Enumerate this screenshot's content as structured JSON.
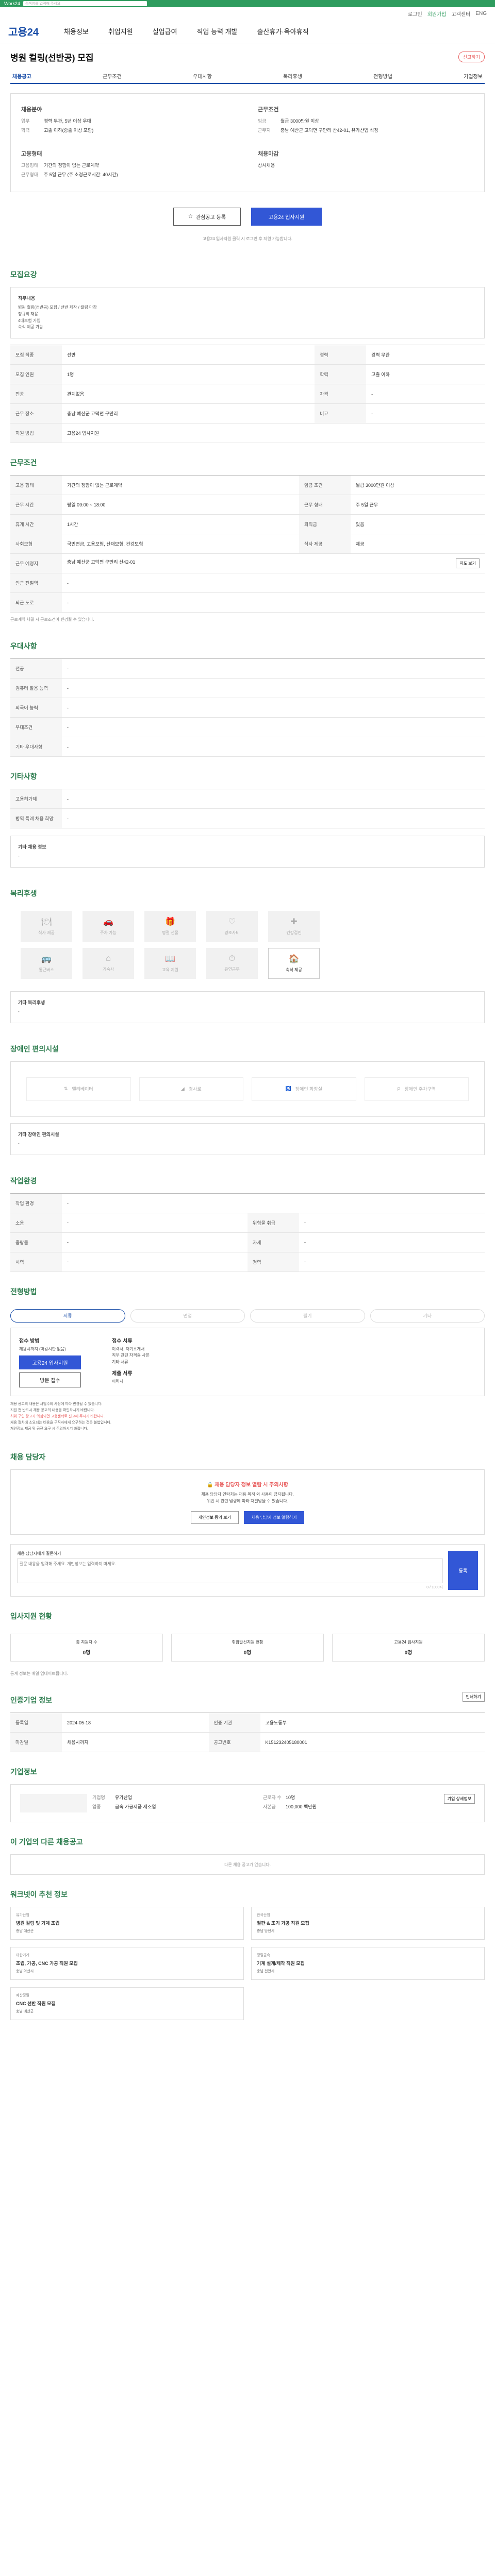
{
  "topbar": {
    "brand": "Work24",
    "search_placeholder": "검색어를 입력해 주세요"
  },
  "util": {
    "items": [
      "로그인",
      "회원가입",
      "고객센터",
      "ENG"
    ]
  },
  "gnb": {
    "logo": "고용24",
    "menu": [
      "채용정보",
      "취업지원",
      "실업급여",
      "직업 능력 개발",
      "출산휴가·육아휴직"
    ]
  },
  "job": {
    "title": "병원 컬링(선반공) 모집",
    "report": "신고하기"
  },
  "tabs": [
    "채용공고",
    "근무조건",
    "우대사항",
    "복리후생",
    "전형방법",
    "기업정보"
  ],
  "summary": {
    "recruit": {
      "heading": "채용분야",
      "rows": [
        {
          "k": "업무",
          "v": "경력 무관, 5년 이상 우대"
        },
        {
          "k": "학력",
          "v": "고졸 이하(중졸 이상 포함)"
        }
      ]
    },
    "condition": {
      "heading": "근무조건",
      "rows": [
        {
          "k": "임금",
          "v": "월급 3000만원 이상"
        },
        {
          "k": "근무지",
          "v": "충남 예산군 고덕면 구만리 산42-01, 유가산업 석정"
        }
      ]
    },
    "type": {
      "heading": "고용형태",
      "rows": [
        {
          "k": "고용형태",
          "v": "기간의 정함이 없는 근로계약"
        },
        {
          "k": "근무형태",
          "v": "주 5일 근무 (주 소정근로시간: 40시간)"
        }
      ]
    },
    "deadline": {
      "heading": "채용마감",
      "rows": [
        {
          "k": "",
          "v": "상시채용"
        }
      ]
    }
  },
  "actions": {
    "save": "관심공고 등록",
    "apply": "고용24 입사지원"
  },
  "notice": "고용24 입사지원 클릭 시 로그인 후 지원 가능합니다.",
  "recruit": {
    "heading": "모집요강",
    "desc_title": "직무내용",
    "desc": [
      "병원 컬링(선반공) 모집 / 선반 제작 / 컬링 마감",
      "정규직 채용",
      "4대보험 가입",
      "숙식 제공 가능"
    ],
    "rows": [
      {
        "k": "모집 직종",
        "v": "선반",
        "k2": "경력",
        "v2": "경력 무관"
      },
      {
        "k": "모집 인원",
        "v": "1명",
        "k2": "학력",
        "v2": "고졸 이하"
      },
      {
        "k": "전공",
        "v": "관계없음",
        "k2": "자격",
        "v2": "-"
      },
      {
        "k": "근무 장소",
        "v": "충남 예산군 고덕면 구만리",
        "k2": "비고",
        "v2": "-"
      },
      {
        "k": "지원 방법",
        "v": "고용24 입사지원",
        "k2": "",
        "v2": ""
      }
    ]
  },
  "conditions": {
    "heading": "근무조건",
    "rows": [
      {
        "k": "고용 형태",
        "v": "기간의 정함이 없는 근로계약",
        "k2": "임금 조건",
        "v2": "월급 3000만원 이상"
      },
      {
        "k": "근무 시간",
        "v": "평일 09:00 ~ 18:00",
        "k2": "근무 형태",
        "v2": "주 5일 근무"
      },
      {
        "k": "휴게 시간",
        "v": "1시간",
        "k2": "퇴직금",
        "v2": "있음"
      },
      {
        "k": "사회보험",
        "v": "국민연금, 고용보험, 산재보험, 건강보험",
        "k2": "식사 제공",
        "v2": "제공"
      },
      {
        "k": "근무 예정지",
        "v": "충남 예산군 고덕면 구만리 산42-01",
        "k2": "",
        "v2": ""
      },
      {
        "k": "인근 전철역",
        "v": "-",
        "k2": "",
        "v2": ""
      },
      {
        "k": "퇴근 도로",
        "v": "-",
        "k2": "",
        "v2": ""
      }
    ],
    "map_btn": "지도 보기",
    "note": "근로계약 체결 시 근로조건이 변경될 수 있습니다."
  },
  "prefer": {
    "heading": "우대사항",
    "rows": [
      {
        "k": "전공",
        "v": "-"
      },
      {
        "k": "컴퓨터 활용 능력",
        "v": "-"
      },
      {
        "k": "외국어 능력",
        "v": "-"
      },
      {
        "k": "우대조건",
        "v": "-"
      },
      {
        "k": "기타 우대사항",
        "v": "-"
      }
    ]
  },
  "other": {
    "heading": "기타사항",
    "rows": [
      {
        "k": "고용허가제",
        "v": "-"
      },
      {
        "k": "병역 특례 채용 희망",
        "v": "-"
      }
    ],
    "extra_title": "기타 채용 정보",
    "extra": "-"
  },
  "welfare": {
    "heading": "복리후생",
    "items": [
      {
        "icon": "food-icon",
        "label": "식사 제공",
        "on": false
      },
      {
        "icon": "car-icon",
        "label": "주차 가능",
        "on": false
      },
      {
        "icon": "gift-icon",
        "label": "명절 선물",
        "on": false
      },
      {
        "icon": "heart-icon",
        "label": "경조사비",
        "on": false
      },
      {
        "icon": "health-icon",
        "label": "건강검진",
        "on": false
      },
      {
        "icon": "bus-icon",
        "label": "통근버스",
        "on": false
      },
      {
        "icon": "house-icon",
        "label": "기숙사",
        "on": false
      },
      {
        "icon": "book-icon",
        "label": "교육 지원",
        "on": false
      },
      {
        "icon": "clock-icon",
        "label": "유연근무",
        "on": false
      },
      {
        "icon": "dorm-icon",
        "label": "숙식 제공",
        "on": true
      }
    ],
    "extra_title": "기타 복리후생",
    "extra": "-"
  },
  "facility": {
    "heading": "장애인 편의시설",
    "items": [
      "엘리베이터",
      "경사로",
      "장애인 화장실",
      "장애인 주차구역"
    ],
    "extra_title": "기타 장애인 편의시설",
    "extra": "-"
  },
  "workenv": {
    "heading": "작업환경",
    "rows": [
      {
        "k": "작업 환경",
        "v": "-",
        "k2": "",
        "v2": ""
      },
      {
        "k": "소음",
        "v": "-",
        "k2": "위험물 취급",
        "v2": "-"
      },
      {
        "k": "중량물",
        "v": "-",
        "k2": "자세",
        "v2": "-"
      },
      {
        "k": "시력",
        "v": "-",
        "k2": "청력",
        "v2": "-"
      }
    ]
  },
  "selection": {
    "heading": "전형방법",
    "steps": [
      {
        "label": "서류",
        "on": true
      },
      {
        "label": "면접",
        "on": false
      },
      {
        "label": "필기",
        "on": false
      },
      {
        "label": "기타",
        "on": false
      }
    ],
    "apply_title": "접수 방법",
    "apply_line": "채용시까지 (마감시한 없음)",
    "apply_btn": "고용24 입사지원",
    "apply_btn2": "방문 접수",
    "doc_title": "접수 서류",
    "doc_lines": [
      "이력서, 자기소개서",
      "직무 관련 자격증 사본",
      "기타 서류"
    ],
    "doc_extra_title": "제출 서류",
    "doc_extra": "이력서"
  },
  "warnings": [
    "채용 공고의 내용은 사업주의 사정에 따라 변경될 수 있습니다.",
    "지원 전 반드시 채용 공고의 내용을 확인하시기 바랍니다.",
    "허위 구인 광고가 의심되면 고용센터로 신고해 주시기 바랍니다.",
    "채용 절차에 소요되는 비용을 구직자에게 요구하는 것은 불법입니다.",
    "개인정보 제공 및 금전 요구 시 주의하시기 바랍니다."
  ],
  "manager": {
    "heading": "채용 담당자",
    "lock": "채용 담당자 정보 열람 시 주의사항",
    "desc": [
      "채용 담당자 연락처는 채용 목적 외 사용이 금지됩니다.",
      "위반 시 관련 법령에 따라 처벌받을 수 있습니다."
    ],
    "btn1": "개인정보 동의 보기",
    "btn2": "채용 담당자 정보 열람하기"
  },
  "qna": {
    "label": "채용 담당자에게 질문하기",
    "placeholder": "질문 내용을 입력해 주세요. 개인정보는 입력하지 마세요.",
    "count": "0 / 1000자",
    "submit": "등록"
  },
  "stats": {
    "heading": "입사지원 현황",
    "items": [
      {
        "label": "총 지원자 수",
        "value": "0명"
      },
      {
        "label": "취업알선지원 현황",
        "value": "0명"
      },
      {
        "label": "고용24 입사지원",
        "value": "0명"
      }
    ],
    "note": "통계 정보는 매일 업데이트됩니다."
  },
  "ad": {
    "heading": "인증기업 정보",
    "print": "인쇄하기",
    "rows": [
      {
        "k": "등록일",
        "v": "2024-05-18",
        "k2": "인증 기관",
        "v2": "고용노동부"
      },
      {
        "k": "마감일",
        "v": "채용시까지",
        "k2": "공고번호",
        "v2": "K151232405180001"
      }
    ]
  },
  "corp": {
    "heading": "기업정보",
    "name_k": "기업명",
    "name": "유가산업",
    "ceo_k": "업종",
    "ceo": "금속 가공제품 제조업",
    "emp_k": "근로자 수",
    "emp": "10명",
    "cap_k": "자본금",
    "cap": "100,000 백만원",
    "detail": "기업 상세정보"
  },
  "related": {
    "heading": "이 기업의 다른 채용공고",
    "empty": "다른 채용 공고가 없습니다."
  },
  "reco": {
    "heading": "워크넷이 추천 정보",
    "cards": [
      {
        "co": "유가산업",
        "title": "병원 컬링 및 기계 조립",
        "meta": "충남 예산군"
      },
      {
        "co": "한국산업",
        "title": "철판 & 조기 가공 직원 모집",
        "meta": "충남 당진시"
      },
      {
        "co": "대한기계",
        "title": "조립, 가공, CNC 가공 직원 모집",
        "meta": "충남 아산시"
      },
      {
        "co": "정밀금속",
        "title": "기계 설계/제작 직원 모집",
        "meta": "충남 천안시"
      },
      {
        "co": "예산정밀",
        "title": "CNC 선반 직원 모집",
        "meta": "충남 예산군"
      }
    ]
  }
}
